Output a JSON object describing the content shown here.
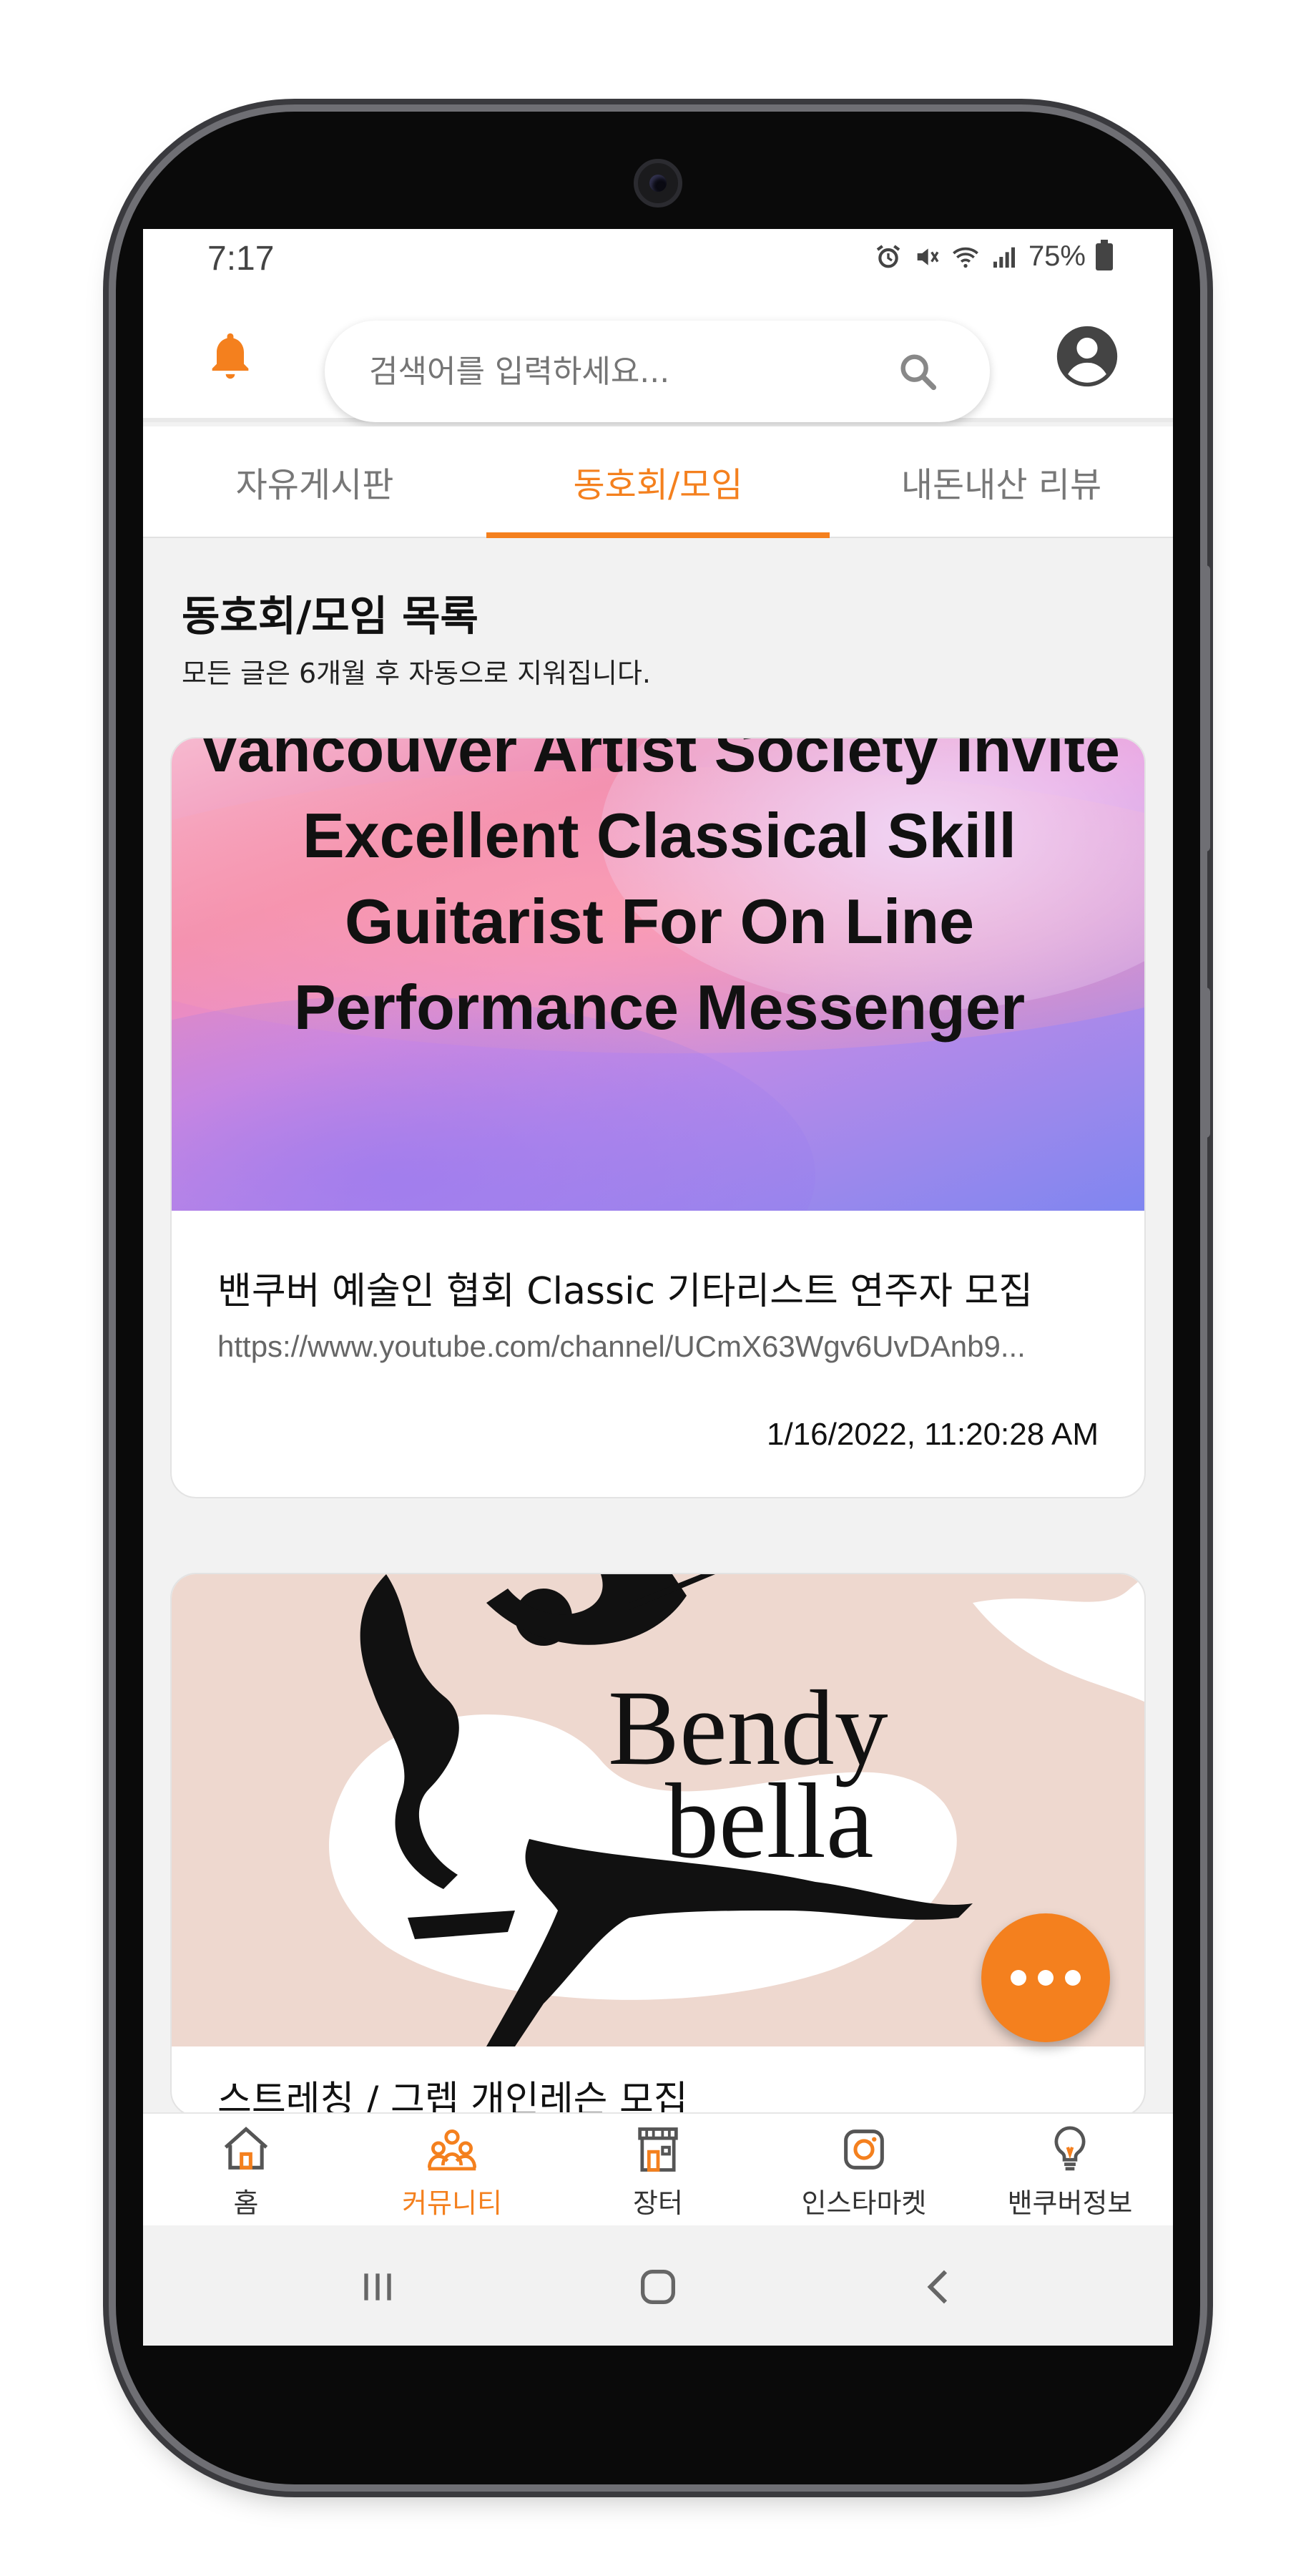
{
  "status": {
    "time": "7:17",
    "battery": "75%"
  },
  "search": {
    "placeholder": "검색어를 입력하세요..."
  },
  "tabs": [
    {
      "label": "자유게시판",
      "active": false
    },
    {
      "label": "동호회/모임",
      "active": true
    },
    {
      "label": "내돈내산 리뷰",
      "active": false
    }
  ],
  "section": {
    "title": "동호회/모임 목록",
    "subtitle": "모든 글은 6개월 후 자동으로 지워집니다."
  },
  "posts": [
    {
      "image_text": "Vancouver Artist Society Invite Excellent Classical Skill Guitarist For On Line Performance Messenger",
      "title": "밴쿠버 예술인 협회 Classic 기타리스트 연주자 모집",
      "link": "https://www.youtube.com/channel/UCmX63Wgv6UvDAnb9...",
      "date": "1/16/2022, 11:20:28 AM"
    },
    {
      "image_text": "Bendy bella",
      "title": "스트레칭 / 그렙 개인레슨 모집"
    }
  ],
  "bottom_nav": [
    {
      "label": "홈",
      "icon": "home-icon",
      "active": false
    },
    {
      "label": "커뮤니티",
      "icon": "community-icon",
      "active": true
    },
    {
      "label": "장터",
      "icon": "market-icon",
      "active": false
    },
    {
      "label": "인스타마켓",
      "icon": "instagram-icon",
      "active": false
    },
    {
      "label": "밴쿠버정보",
      "icon": "lightbulb-icon",
      "active": false
    }
  ],
  "colors": {
    "accent": "#f4801e",
    "background": "#f2f2f2"
  }
}
